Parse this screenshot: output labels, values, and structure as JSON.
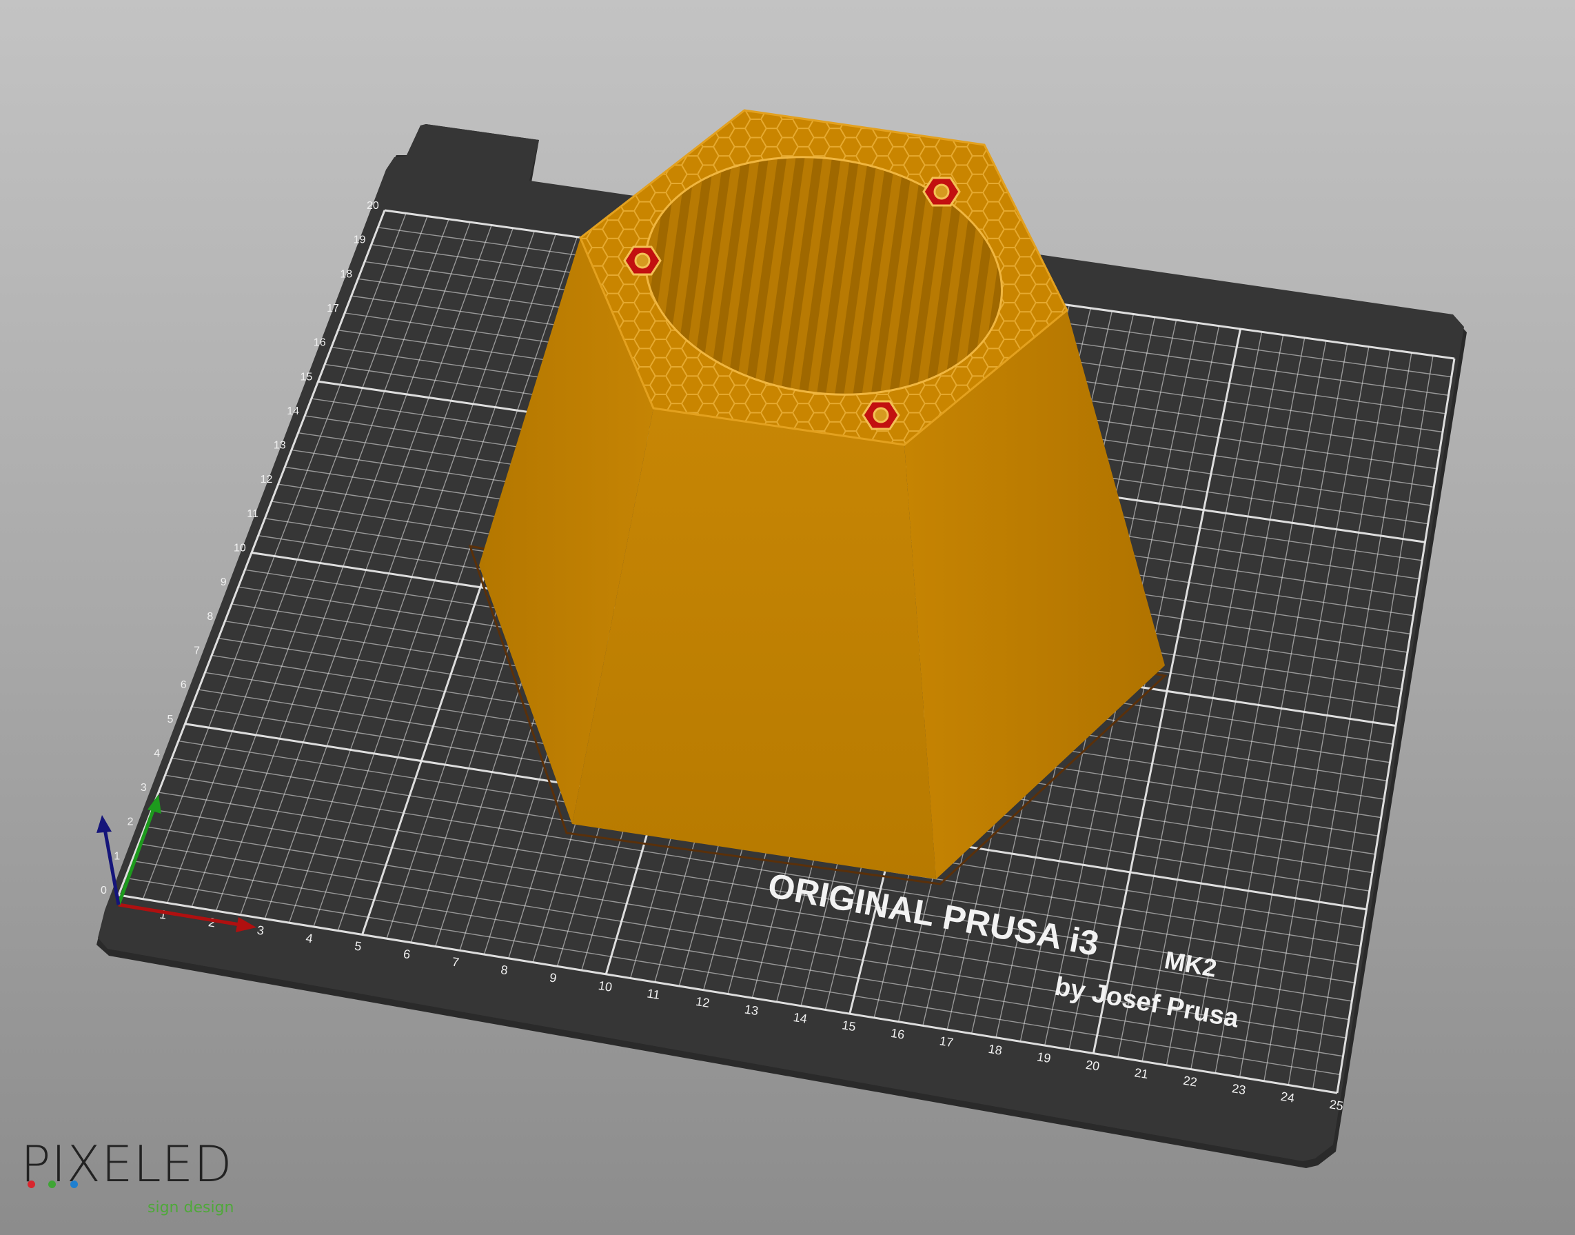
{
  "bed": {
    "title": "ORIGINAL PRUSA i3",
    "model": "MK2",
    "byline": "by Josef Prusa",
    "x_ticks": [
      "1",
      "2",
      "3",
      "4",
      "5",
      "6",
      "7",
      "8",
      "9",
      "10",
      "11",
      "12",
      "13",
      "14",
      "15",
      "16",
      "17",
      "18",
      "19",
      "20",
      "21",
      "22",
      "23",
      "24",
      "25"
    ],
    "y_ticks": [
      "0",
      "1",
      "2",
      "3",
      "4",
      "5",
      "6",
      "7",
      "8",
      "9",
      "10",
      "11",
      "12",
      "13",
      "14",
      "15",
      "16",
      "17",
      "18",
      "19",
      "20"
    ]
  },
  "model_object": {
    "shape": "hexagonal-tapered-vase",
    "infill": "honeycomb",
    "color": "#c98500"
  },
  "axes": {
    "x_color": "#b01010",
    "y_color": "#1d9a1d",
    "z_color": "#15157a"
  },
  "branding": {
    "logo_word": "PIXELED",
    "tagline": "sign design",
    "dot_colors": [
      "#d8262e",
      "#3fa535",
      "#1e7fd0"
    ],
    "tagline_color": "#4fa83a"
  }
}
